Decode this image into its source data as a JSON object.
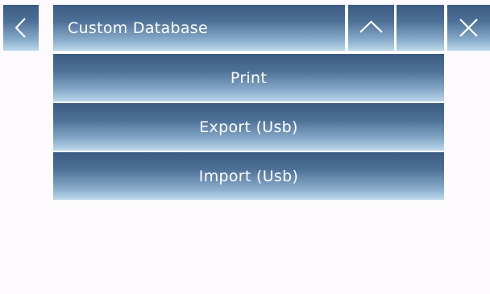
{
  "header": {
    "title": "Custom Database",
    "back_icon": "chevron-left-icon",
    "up_icon": "chevron-up-icon",
    "close_icon": "close-icon"
  },
  "menu": {
    "items": [
      {
        "label": "Print"
      },
      {
        "label": "Export (Usb)"
      },
      {
        "label": "Import (Usb)"
      }
    ]
  },
  "colors": {
    "button_top": "#3b5a82",
    "button_bottom": "#bcd8ec",
    "background": "#fdfbfe",
    "text": "#ffffff"
  }
}
